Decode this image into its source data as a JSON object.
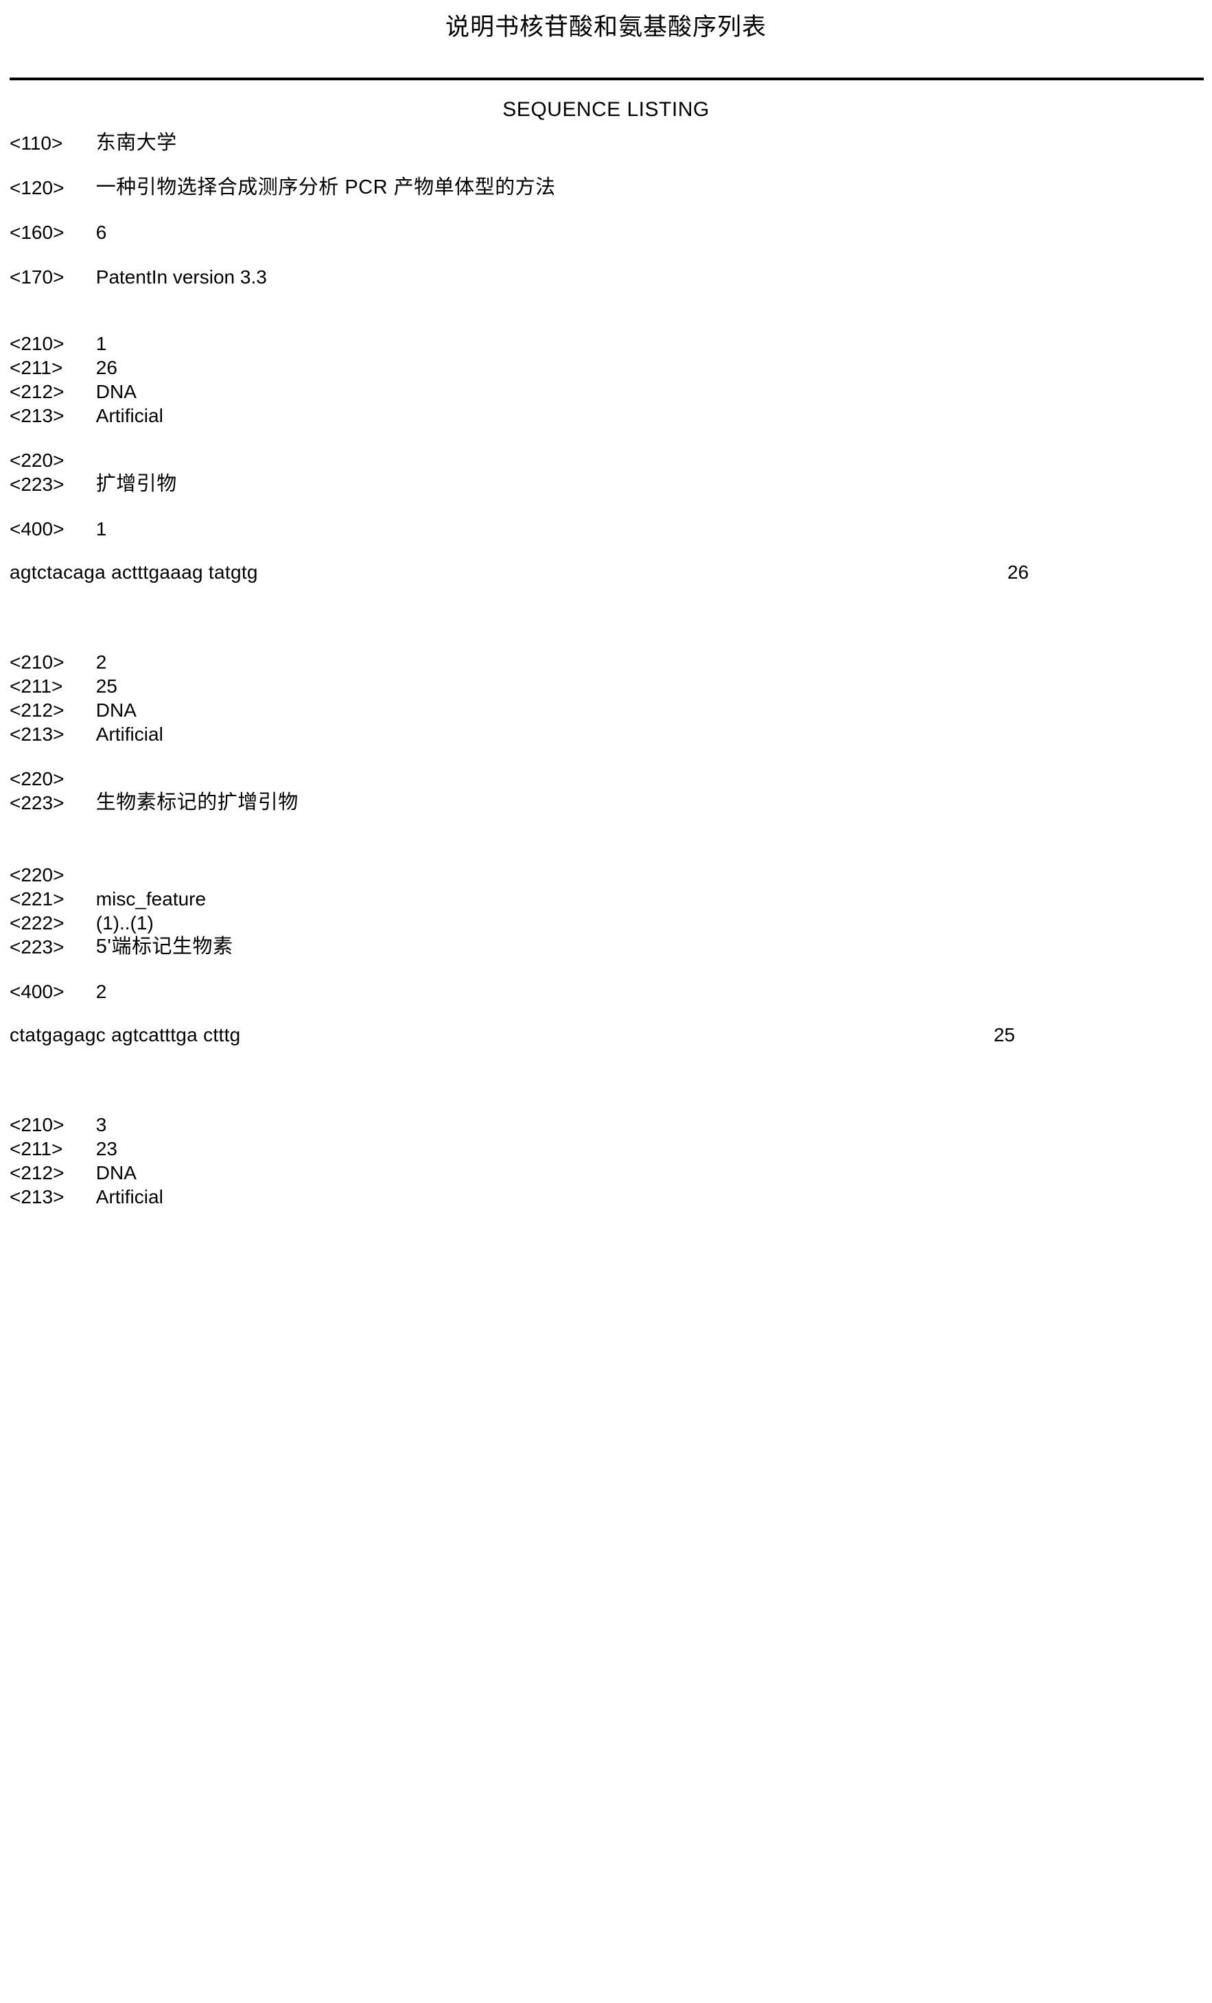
{
  "header": {
    "running_title": "说明书核苷酸和氨基酸序列表",
    "listing_title": "SEQUENCE LISTING"
  },
  "front_matter": [
    {
      "tag": "<110>",
      "value": "东南大学",
      "cjk": true
    },
    {
      "tag": "<120>",
      "value": "一种引物选择合成测序分析 PCR 产物单体型的方法",
      "cjk": true
    },
    {
      "tag": "<160>",
      "value": "6",
      "cjk": false
    },
    {
      "tag": "<170>",
      "value": "PatentIn version 3.3",
      "cjk": false
    }
  ],
  "sequences": [
    {
      "id": "1",
      "seq_id_tag": "<210>",
      "seq_id_value": "1",
      "length_tag": "<211>",
      "length_value": "26",
      "type_tag": "<212>",
      "type_value": "DNA",
      "organism_tag": "<213>",
      "organism_value": "Artificial",
      "features": [
        {
          "feature_tag": "<220>",
          "feature_value": "",
          "rows": [
            {
              "tag": "<223>",
              "value": "扩增引物",
              "cjk": true
            }
          ]
        }
      ],
      "sequence_tag": "<400>",
      "sequence_number": "1",
      "sequence_text": "agtctacaga actttgaaag tatgtg",
      "sequence_count": "26"
    },
    {
      "id": "2",
      "seq_id_tag": "<210>",
      "seq_id_value": "2",
      "length_tag": "<211>",
      "length_value": "25",
      "type_tag": "<212>",
      "type_value": "DNA",
      "organism_tag": "<213>",
      "organism_value": "Artificial",
      "features": [
        {
          "feature_tag": "<220>",
          "feature_value": "",
          "rows": [
            {
              "tag": "<223>",
              "value": "生物素标记的扩增引物",
              "cjk": true
            }
          ]
        },
        {
          "feature_tag": "<220>",
          "feature_value": "",
          "rows": [
            {
              "tag": "<221>",
              "value": "misc_feature",
              "cjk": false
            },
            {
              "tag": "<222>",
              "value": "(1)..(1)",
              "cjk": false
            },
            {
              "tag": "<223>",
              "value": "5'端标记生物素",
              "cjk": true
            }
          ]
        }
      ],
      "sequence_tag": "<400>",
      "sequence_number": "2",
      "sequence_text": "ctatgagagc agtcatttga ctttg",
      "sequence_count": "25"
    },
    {
      "id": "3",
      "seq_id_tag": "<210>",
      "seq_id_value": "3",
      "length_tag": "<211>",
      "length_value": "23",
      "type_tag": "<212>",
      "type_value": "DNA",
      "organism_tag": "<213>",
      "organism_value": "Artificial",
      "features": [],
      "sequence_tag": "",
      "sequence_number": "",
      "sequence_text": "",
      "sequence_count": ""
    }
  ]
}
